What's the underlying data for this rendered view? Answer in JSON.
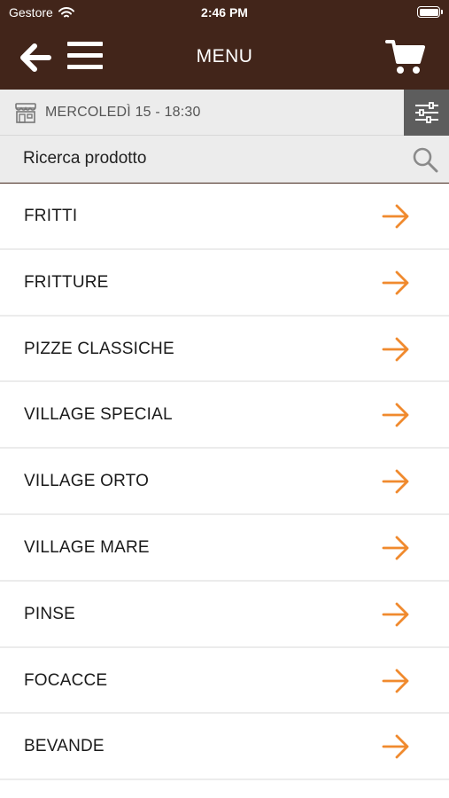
{
  "status": {
    "carrier": "Gestore",
    "time": "2:46 PM"
  },
  "header": {
    "title": "MENU"
  },
  "date_bar": {
    "text": "MERCOLEDÌ 15 - 18:30"
  },
  "search": {
    "placeholder": "Ricerca prodotto"
  },
  "categories": [
    {
      "label": "FRITTI"
    },
    {
      "label": "FRITTURE"
    },
    {
      "label": "PIZZE CLASSICHE"
    },
    {
      "label": "VILLAGE SPECIAL"
    },
    {
      "label": "VILLAGE ORTO"
    },
    {
      "label": "VILLAGE MARE"
    },
    {
      "label": "PINSE"
    },
    {
      "label": "FOCACCE"
    },
    {
      "label": "BEVANDE"
    }
  ],
  "colors": {
    "header_bg": "#42251a",
    "accent": "#f08a2e",
    "bar_bg": "#ececec",
    "filter_bg": "#5d5d5d"
  },
  "icons": [
    "wifi-icon",
    "battery-icon",
    "back-arrow-icon",
    "hamburger-menu-icon",
    "cart-icon",
    "shop-icon",
    "filter-sliders-icon",
    "search-icon",
    "chevron-arrow-right-icon"
  ]
}
